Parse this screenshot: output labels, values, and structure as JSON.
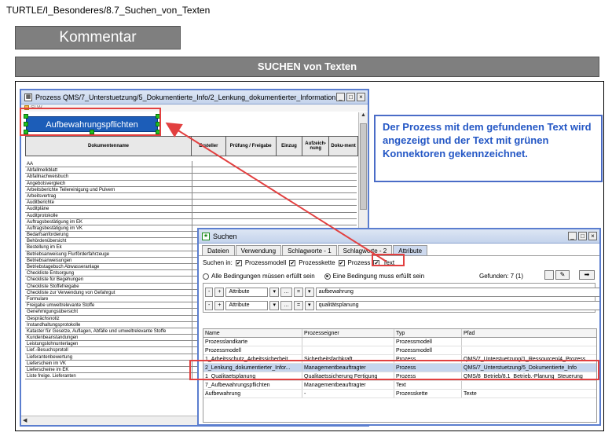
{
  "breadcrumb": "TURTLE/I_Besonderes/8.7_Suchen_von_Texten",
  "kommentar_label": "Kommentar",
  "section_title": "SUCHEN von Texten",
  "process_window": {
    "title": "Prozess QMS/7_Unterstuetzung/5_Dokumentierte_Info/2_Lenkung_dokumentierter_Information:Managemen...",
    "slw_label": "SLW",
    "highlight_box": "Aufbewahrungspflichten",
    "columns": [
      "Dokumentenname",
      "Ersteller",
      "Prüfung / Freigabe",
      "Einzug",
      "Aufzeich-nung",
      "Doku-ment"
    ],
    "documents": [
      "AA",
      "Abfallmelkblatt",
      "Abfallnachweisbuch",
      "Angebotsvergleich",
      "Arbeitsberichte Teilereinigung und Pulvern",
      "Arbeitsvertrag",
      "Auditberichte",
      "Auditpläne",
      "Auditprotokolle",
      "Auftragsbestätigung im EK",
      "Auftragsbestätigung im VK",
      "Bedarfsanforderung",
      "Behördenübersicht",
      "Bestellung im Ek",
      "Betriebsanweisung Flurförderfahrzeuge",
      "Betriebsanweisungen",
      "Betriebstagebuch Abwasseranlage",
      "Checkliste Entsorgung",
      "Checkliste für Begehungen",
      "Checkliste Stoffefreigabe",
      "Checkliste zur Verwendung von Gefahrgut",
      "Formulare",
      "Freigabe umweltrelevante Stoffe",
      "Genehmigungsübersicht",
      "Gesprächsnotiz",
      "Instandhaltungsprotokolle",
      "Kataster für Gesetze, Auflagen, Abfälle und umweltrelevante Stoffe",
      "Kundenbeanstandungen",
      "Leistungslohnunterlagen",
      "Lief.-Besuchsprotoll",
      "Lieferantenbewertung",
      "Lieferschein im VK",
      "Lieferscheine im EK",
      "Liste freige. Lieferanten"
    ]
  },
  "note_text": "Der Prozess mit dem gefundenen Text wird angezeigt und der Text mit grünen Konnektoren gekennzeichnet.",
  "search_window": {
    "title": "Suchen",
    "tabs": [
      "Dateien",
      "Verwendung",
      "Schlagworte - 1",
      "Schlagworte - 2",
      "Attribute"
    ],
    "suchen_in_label": "Suchen in:",
    "checkboxes": [
      "Prozessmodell",
      "Prozesskette",
      "Prozess",
      "Text"
    ],
    "radio_all": "Alle Bedingungen müssen erfüllt sein",
    "radio_one": "Eine Bedingung muss erfüllt sein",
    "found": "Gefunden: 7 (1)",
    "conditions": [
      {
        "field": "Attribute",
        "op": "=",
        "value": "aufbewahrung"
      },
      {
        "field": "Attribute",
        "op": "=",
        "value": "qualitätsplanung"
      }
    ],
    "results_columns": [
      "Name",
      "Prozesseigner",
      "Typ",
      "Pfad"
    ],
    "results": [
      {
        "name": "Prozesslandkarte",
        "owner": "",
        "type": "Prozessmodell",
        "path": ""
      },
      {
        "name": "Prozessmodell",
        "owner": "",
        "type": "Prozessmodell",
        "path": ""
      },
      {
        "name": "1_Arbeitsschutz_Arbeitssicherheit",
        "owner": "Sicherheitsfachkraft",
        "type": "Prozess",
        "path": "QMS/7_Unterstuetzung/1_Ressourcen/4_Prozess"
      },
      {
        "name": "2_Lenkung_dokumentierter_Infor...",
        "owner": "Managementbeauftragter",
        "type": "Prozess",
        "path": "QMS/7_Unterstuetzung/5_Dokumentierte_Info"
      },
      {
        "name": "1_Qualitaetsplanung",
        "owner": "Qualitaetssicherung Fertigung",
        "type": "Prozess",
        "path": "QMS/8_Betrieb/8.1_Betrieb.-Planung_Steuerung"
      },
      {
        "name": "7_Aufbewahrungspflichten",
        "owner": "Managementbeauftragter",
        "type": "Text",
        "path": ""
      },
      {
        "name": "Aufbewahrung",
        "owner": "-",
        "type": "Prozesskette",
        "path": "Texte"
      }
    ]
  }
}
